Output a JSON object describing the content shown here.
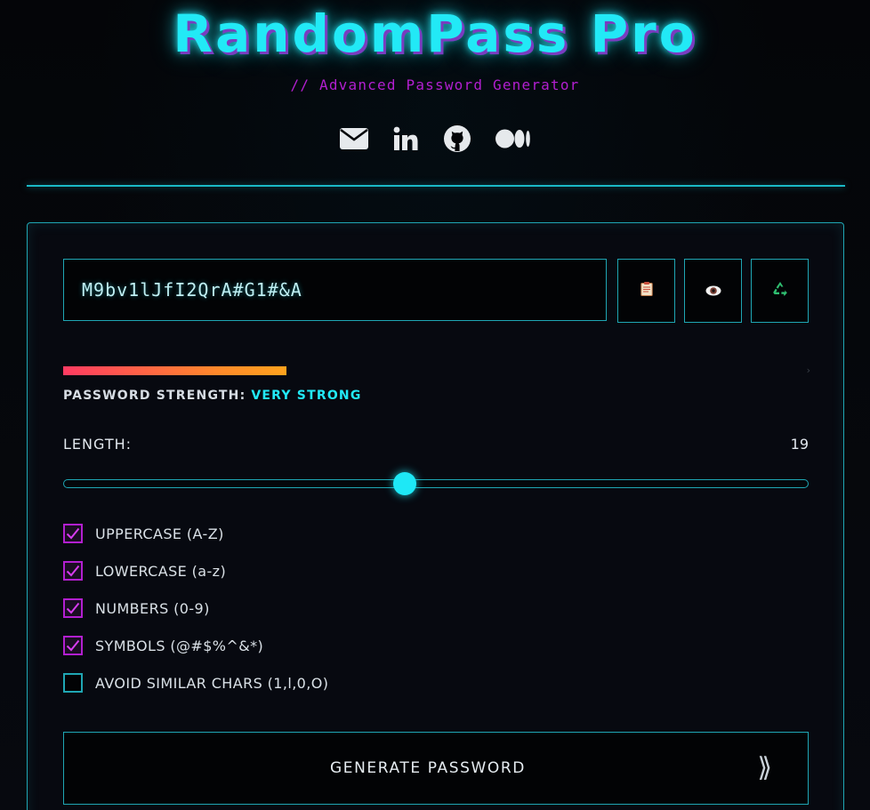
{
  "header": {
    "title": "RandomPass Pro",
    "subtitle": "// Advanced Password Generator",
    "socials": [
      {
        "icon": "envelope-icon"
      },
      {
        "icon": "linkedin-icon"
      },
      {
        "icon": "github-icon"
      },
      {
        "icon": "medium-icon"
      }
    ]
  },
  "password": {
    "value": "M9bv1lJfI2QrA#G1#&A"
  },
  "actions": {
    "copy_icon": "clipboard-icon",
    "reveal_icon": "eye-icon",
    "regenerate_icon": "recycle-icon"
  },
  "strength": {
    "label": "PASSWORD STRENGTH:",
    "value": "VERY STRONG",
    "level": 0.3
  },
  "length": {
    "label": "LENGTH:",
    "value": "19",
    "min": 8,
    "max": 32,
    "current": 19
  },
  "options": [
    {
      "label": "UPPERCASE (A-Z)",
      "checked": true
    },
    {
      "label": "LOWERCASE (a-z)",
      "checked": true
    },
    {
      "label": "NUMBERS (0-9)",
      "checked": true
    },
    {
      "label": "SYMBOLS (@#$%^&*)",
      "checked": true
    },
    {
      "label": "AVOID SIMILAR CHARS (1,l,0,O)",
      "checked": false
    }
  ],
  "generate": {
    "label": "GENERATE PASSWORD",
    "arrow": "⟫"
  },
  "colors": {
    "accent_cyan": "#22e9f6",
    "accent_magenta": "#b21fd0",
    "border": "#1fa6b4",
    "strength_start": "#ff3b62",
    "strength_end": "#ffa21d"
  }
}
